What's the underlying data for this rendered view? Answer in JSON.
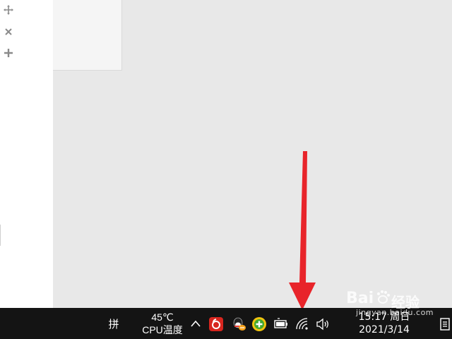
{
  "taskbar": {
    "ime_label": "拼",
    "cpu_temp_value": "45℃",
    "cpu_temp_label": "CPU温度",
    "clock_time": "15:17 周日",
    "clock_date": "2021/3/14",
    "tray_icons": [
      "chevron-up-icon",
      "netease-music-icon",
      "qq-icon",
      "green-plus-app-icon",
      "battery-icon",
      "wifi-icon",
      "volume-icon"
    ]
  },
  "left_toolbar": {
    "icons": [
      "move-icon",
      "close-icon",
      "add-icon"
    ]
  },
  "watermark": {
    "brand": "Bai",
    "brand_suffix": "经验",
    "url": "jingyan.baidu.com"
  },
  "colors": {
    "taskbar": "#141414",
    "background": "#e8e8e8",
    "arrow": "#e8242a"
  }
}
